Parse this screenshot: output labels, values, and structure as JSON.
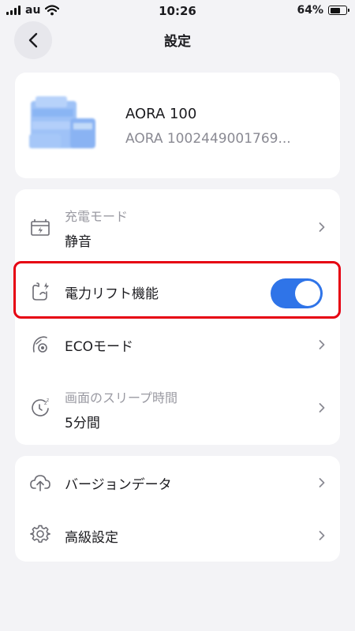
{
  "status_bar": {
    "carrier": "au",
    "time": "10:26",
    "battery_percent": "64%",
    "battery_level": 0.64
  },
  "header": {
    "title": "設定",
    "back_icon": "chevron-left-icon"
  },
  "device": {
    "name": "AORA 100",
    "serial": "AORA 1002449001769..."
  },
  "settings": {
    "charge_mode": {
      "label": "充電モード",
      "value": "静音",
      "icon": "charger-icon"
    },
    "power_lift": {
      "label": "電力リフト機能",
      "enabled": true,
      "icon": "power-lift-icon"
    },
    "eco_mode": {
      "label": "ECOモード",
      "icon": "eco-icon"
    },
    "screen_sleep": {
      "label": "画面のスリープ時間",
      "value": "5分間",
      "icon": "sleep-timer-icon"
    }
  },
  "more": {
    "version": {
      "label": "バージョンデータ",
      "icon": "cloud-upload-icon"
    },
    "advanced": {
      "label": "高級設定",
      "icon": "gear-icon"
    }
  },
  "colors": {
    "accent": "#2f74e8",
    "highlight": "#e60012",
    "background": "#f3f3f6",
    "muted_text": "#9a9aa2"
  }
}
